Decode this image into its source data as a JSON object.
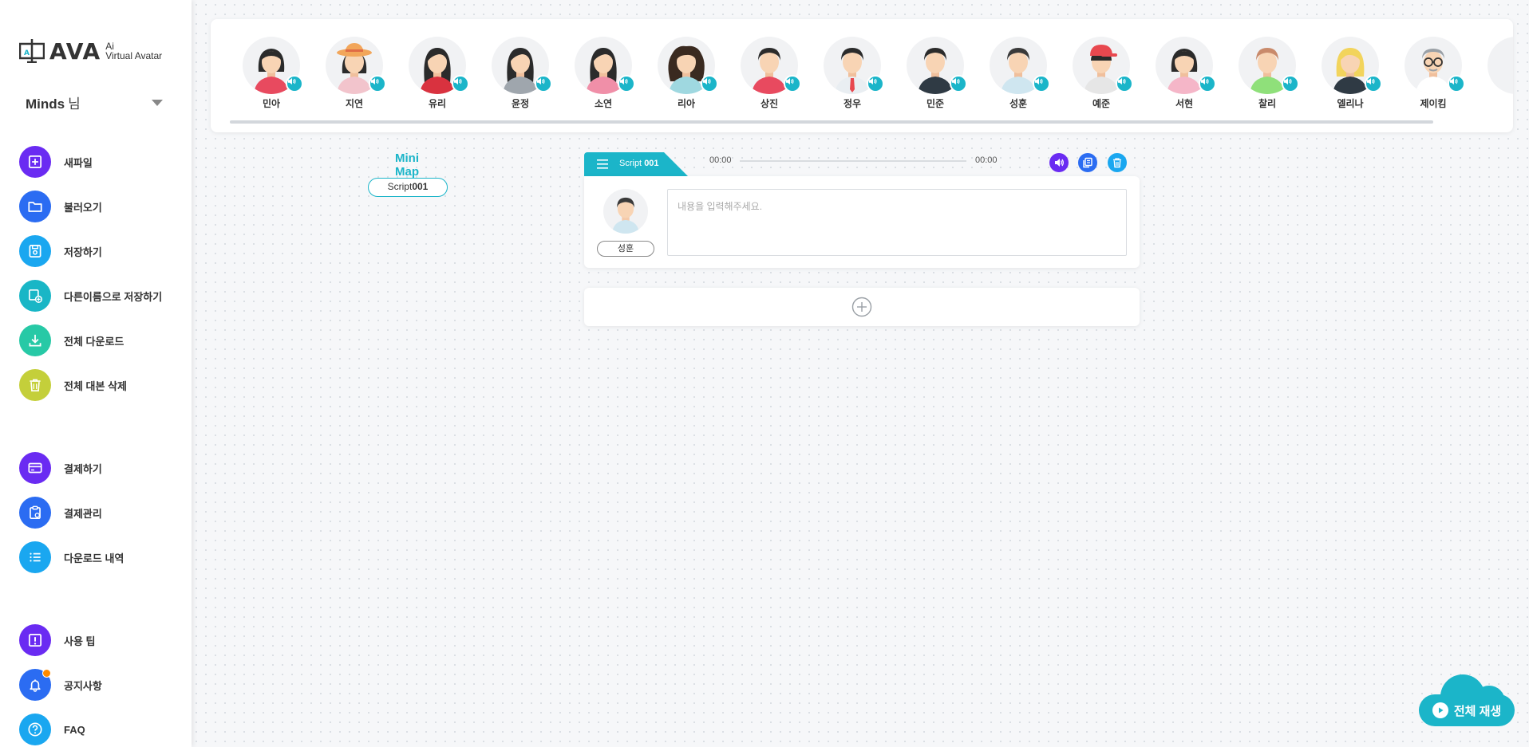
{
  "logo": {
    "text": "AVA",
    "sub_line1": "Ai",
    "sub_line2": "Virtual Avatar"
  },
  "user": {
    "name": "Minds",
    "suffix": "님"
  },
  "menu": {
    "file": [
      {
        "label": "새파일",
        "icon": "plus-square-icon",
        "color": "#6a2bf2"
      },
      {
        "label": "불러오기",
        "icon": "folder-icon",
        "color": "#2b6cf2"
      },
      {
        "label": "저장하기",
        "icon": "save-icon",
        "color": "#1aa7f0"
      },
      {
        "label": "다른이름으로 저장하기",
        "icon": "save-as-icon",
        "color": "#19b6c6"
      },
      {
        "label": "전체 다운로드",
        "icon": "download-icon",
        "color": "#27c9a6"
      },
      {
        "label": "전체 대본 삭제",
        "icon": "trash-icon",
        "color": "#c4cf3a"
      }
    ],
    "billing": [
      {
        "label": "결제하기",
        "icon": "credit-card-icon",
        "color": "#6a2bf2"
      },
      {
        "label": "결제관리",
        "icon": "clipboard-icon",
        "color": "#2b6cf2"
      },
      {
        "label": "다운로드 내역",
        "icon": "list-icon",
        "color": "#1aa7f0"
      }
    ],
    "help": [
      {
        "label": "사용 팁",
        "icon": "alert-icon",
        "color": "#6a2bf2"
      },
      {
        "label": "공지사항",
        "icon": "bell-icon",
        "color": "#2b6cf2"
      },
      {
        "label": "FAQ",
        "icon": "question-icon",
        "color": "#1aa7f0"
      }
    ]
  },
  "avatars": [
    {
      "name": "민아",
      "hair": "#2b2b2b",
      "shirt": "#e84a5f",
      "accessory": "bob"
    },
    {
      "name": "지연",
      "hair": "#2b2b2b",
      "shirt": "#f2c4cc",
      "accessory": "hat"
    },
    {
      "name": "유리",
      "hair": "#2b2b2b",
      "shirt": "#d9323f",
      "accessory": "long"
    },
    {
      "name": "윤정",
      "hair": "#2b2b2b",
      "shirt": "#9fa6ad",
      "accessory": "long"
    },
    {
      "name": "소연",
      "hair": "#2b2b2b",
      "shirt": "#f08fa8",
      "accessory": "long"
    },
    {
      "name": "리아",
      "hair": "#3a2a20",
      "shirt": "#9fd8e0",
      "accessory": "curly"
    },
    {
      "name": "상진",
      "hair": "#2b2b2b",
      "shirt": "#e84a5f",
      "accessory": "short"
    },
    {
      "name": "정우",
      "hair": "#2b2b2b",
      "shirt": "#e9eef2",
      "accessory": "tie"
    },
    {
      "name": "민준",
      "hair": "#2b2b2b",
      "shirt": "#2f3a44",
      "accessory": "short"
    },
    {
      "name": "성훈",
      "hair": "#3a3a3a",
      "shirt": "#cfe6f0",
      "accessory": "short"
    },
    {
      "name": "예준",
      "hair": "#2b2b2b",
      "shirt": "#e6e6e6",
      "accessory": "cap"
    },
    {
      "name": "서현",
      "hair": "#2b2b2b",
      "shirt": "#f5b6c8",
      "accessory": "bob"
    },
    {
      "name": "찰리",
      "hair": "#c98a6b",
      "shirt": "#8fe07a",
      "accessory": "short"
    },
    {
      "name": "엘리나",
      "hair": "#f2d45c",
      "shirt": "#2f3a44",
      "accessory": "blonde"
    },
    {
      "name": "제이킴",
      "hair": "#9aa0a6",
      "shirt": "#ffffff",
      "accessory": "glasses"
    }
  ],
  "minimap": {
    "title": "Mini Map",
    "item_prefix": "Script",
    "item_number": "001"
  },
  "script": {
    "tab_prefix": "Script",
    "tab_number": "001",
    "time_start": "00:00",
    "time_end": "00:00",
    "speaker": "성훈",
    "placeholder": "내용을 입력해주세요.",
    "value": ""
  },
  "controls": [
    {
      "icon": "voice-icon",
      "color": "#6a2bf2"
    },
    {
      "icon": "copy-icon",
      "color": "#2b6cf2"
    },
    {
      "icon": "delete-icon",
      "color": "#1aa7f0"
    }
  ],
  "play_all": {
    "label": "전체 재생"
  },
  "colors": {
    "accent": "#1bb5c9",
    "notification": "#ff8a00"
  }
}
